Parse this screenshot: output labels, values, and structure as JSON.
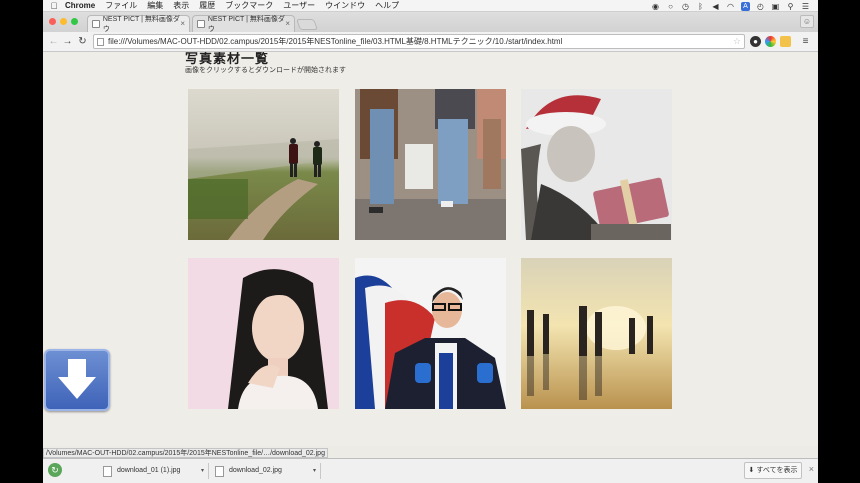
{
  "menubar": {
    "apple": "",
    "app": "Chrome",
    "items": [
      "ファイル",
      "編集",
      "表示",
      "履歴",
      "ブックマーク",
      "ユーザー",
      "ウインドウ",
      "ヘルプ"
    ],
    "status_icons": [
      "record-icon",
      "circle-icon",
      "time-machine-icon",
      "bluetooth-icon",
      "volume-icon",
      "wifi-icon",
      "input-a-icon",
      "clock-icon",
      "lock-icon",
      "search-icon",
      "list-icon"
    ],
    "input_label": "A"
  },
  "tabs": [
    {
      "title": "NEST PICT | 無料画像ダウ",
      "active": true
    },
    {
      "title": "NEST PICT | 無料画像ダウ",
      "active": false
    }
  ],
  "toolbar": {
    "url": "file:///Volumes/MAC-OUT-HDD/02.campus/2015年/2015年NESTonline_file/03.HTML基礎/8.HTMLテクニック/10./start/index.html"
  },
  "page": {
    "title": "写真素材一覧",
    "subtitle": "画像をクリックするとダウンロードが開始されます"
  },
  "photos": [
    {
      "subject": "couple-walking-field"
    },
    {
      "subject": "crowd-shopping-bags"
    },
    {
      "subject": "woman-santa-hat-gift"
    },
    {
      "subject": "woman-thinking"
    },
    {
      "subject": "superhero-businessman-flag"
    },
    {
      "subject": "people-silhouettes-sunset"
    }
  ],
  "status_url": "/Volumes/MAC-OUT-HDD/02.campus/2015年/2015年NESTonline_file/…/download_02.jpg",
  "downloads": {
    "items": [
      {
        "name": "download_01 (1).jpg"
      },
      {
        "name": "download_02.jpg"
      }
    ],
    "show_all": "すべてを表示",
    "close": "×"
  },
  "colors": {
    "page_bg": "#efede8",
    "download_button": "#4f72c4"
  }
}
